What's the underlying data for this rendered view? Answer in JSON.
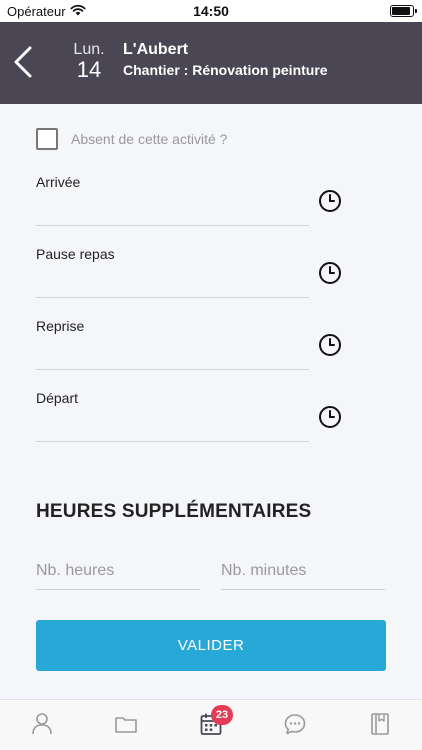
{
  "status_bar": {
    "carrier": "Opérateur",
    "time": "14:50"
  },
  "header": {
    "day_name": "Lun.",
    "day_number": "14",
    "client_name": "L'Aubert",
    "site_name": "Chantier : Rénovation peinture"
  },
  "form": {
    "absent_label": "Absent de cette activité ?",
    "absent_checked": false,
    "fields": [
      {
        "label": "Arrivée"
      },
      {
        "label": "Pause repas"
      },
      {
        "label": "Reprise"
      },
      {
        "label": "Départ"
      }
    ],
    "overtime_title": "HEURES SUPPLÉMENTAIRES",
    "hours_placeholder": "Nb. heures",
    "minutes_placeholder": "Nb. minutes",
    "hours_value": "",
    "minutes_value": "",
    "submit_label": "VALIDER"
  },
  "tab_bar": {
    "tabs": [
      {
        "icon": "person-icon"
      },
      {
        "icon": "folder-icon"
      },
      {
        "icon": "calendar-icon",
        "active": true
      },
      {
        "icon": "chat-icon"
      },
      {
        "icon": "book-icon"
      }
    ],
    "calendar_badge": "23"
  },
  "colors": {
    "header_bg": "#4a4653",
    "accent": "#28a8d6",
    "badge": "#e23c56",
    "page_bg": "#f5f6fa"
  }
}
